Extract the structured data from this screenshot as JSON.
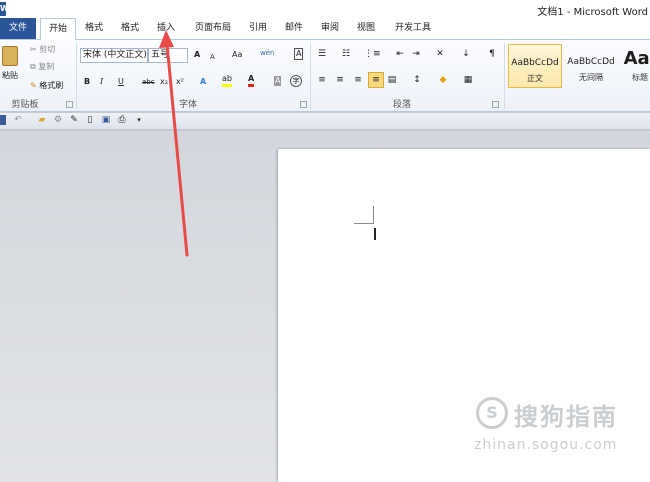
{
  "window": {
    "title": "文档1 - Microsoft Word",
    "app_icon": "W"
  },
  "tabs": {
    "file": "文件",
    "home": "开始",
    "format1": "格式",
    "format2": "格式",
    "insert": "插入",
    "page_layout": "页面布局",
    "references": "引用",
    "mailings": "邮件",
    "review": "审阅",
    "view": "视图",
    "developer": "开发工具"
  },
  "clipboard": {
    "paste": "粘贴",
    "cut": "剪切",
    "copy": "复制",
    "format_painter": "格式刷",
    "group_label": "剪贴板"
  },
  "font": {
    "font_name": "宋体 (中文正文)",
    "font_size": "五号",
    "grow": "A",
    "shrink": "A",
    "change_case": "Aa",
    "pinyin": "wén",
    "char_border": "A",
    "bold": "B",
    "italic": "I",
    "underline": "U",
    "strike": "abc",
    "subscript": "x₂",
    "superscript": "x²",
    "effects": "A",
    "highlight": "ab",
    "font_color": "A",
    "char_shading": "A",
    "enclose": "字",
    "group_label": "字体"
  },
  "paragraph": {
    "group_label": "段落"
  },
  "styles": {
    "items": [
      {
        "sample": "AaBbCcDd",
        "name": "正文"
      },
      {
        "sample": "AaBbCcDd",
        "name": "无间隔"
      },
      {
        "sample": "AaI",
        "name": "标题"
      }
    ]
  },
  "watermark": {
    "logo": "S",
    "text": "搜狗指南",
    "url": "zhinan.sogou.com"
  },
  "colors": {
    "file_tab": "#2a5699",
    "annotation_arrow": "#e84a4a",
    "highlight_yellow": "#f6ff00",
    "font_red": "#e0261b"
  }
}
